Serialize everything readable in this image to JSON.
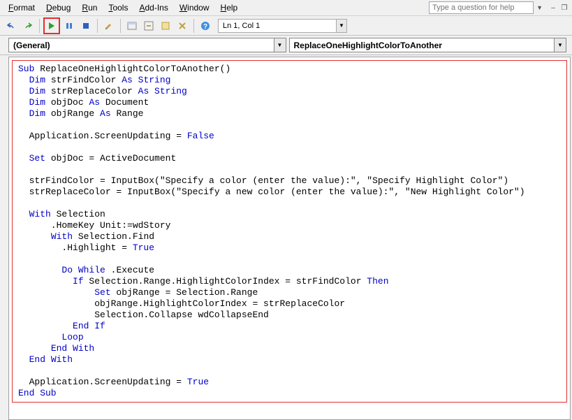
{
  "menu": {
    "format": "Format",
    "debug": "Debug",
    "run": "Run",
    "tools": "Tools",
    "addins": "Add-Ins",
    "window": "Window",
    "help": "Help"
  },
  "helpPlaceholder": "Type a question for help",
  "position": "Ln 1, Col 1",
  "dropdowns": {
    "left": "(General)",
    "right": "ReplaceOneHighlightColorToAnother"
  },
  "code": {
    "l1a": "Sub",
    "l1b": " ReplaceOneHighlightColorToAnother()",
    "l2a": "Dim",
    "l2b": " strFindColor ",
    "l2c": "As String",
    "l3a": "Dim",
    "l3b": " strReplaceColor ",
    "l3c": "As String",
    "l4a": "Dim",
    "l4b": " objDoc ",
    "l4c": "As",
    "l4d": " Document",
    "l5a": "Dim",
    "l5b": " objRange ",
    "l5c": "As",
    "l5d": " Range",
    "l6": "  Application.ScreenUpdating = ",
    "l6b": "False",
    "l7a": "Set",
    "l7b": " objDoc = ActiveDocument",
    "l8": "  strFindColor = InputBox(\"Specify a color (enter the value):\", \"Specify Highlight Color\")",
    "l9": "  strReplaceColor = InputBox(\"Specify a new color (enter the value):\", \"New Highlight Color\")",
    "l10a": "With",
    "l10b": " Selection",
    "l11": "      .HomeKey Unit:=wdStory",
    "l12a": "With",
    "l12b": " Selection.Find",
    "l13": "        .Highlight = ",
    "l13b": "True",
    "l14a": "Do While",
    "l14b": " .Execute",
    "l15a": "If",
    "l15b": " Selection.Range.HighlightColorIndex = strFindColor ",
    "l15c": "Then",
    "l16a": "Set",
    "l16b": " objRange = Selection.Range",
    "l17": "              objRange.HighlightColorIndex = strReplaceColor",
    "l18": "              Selection.Collapse wdCollapseEnd",
    "l19": "End If",
    "l20": "Loop",
    "l21": "End With",
    "l22": "End With",
    "l23": "  Application.ScreenUpdating = ",
    "l23b": "True",
    "l24": "End Sub"
  }
}
